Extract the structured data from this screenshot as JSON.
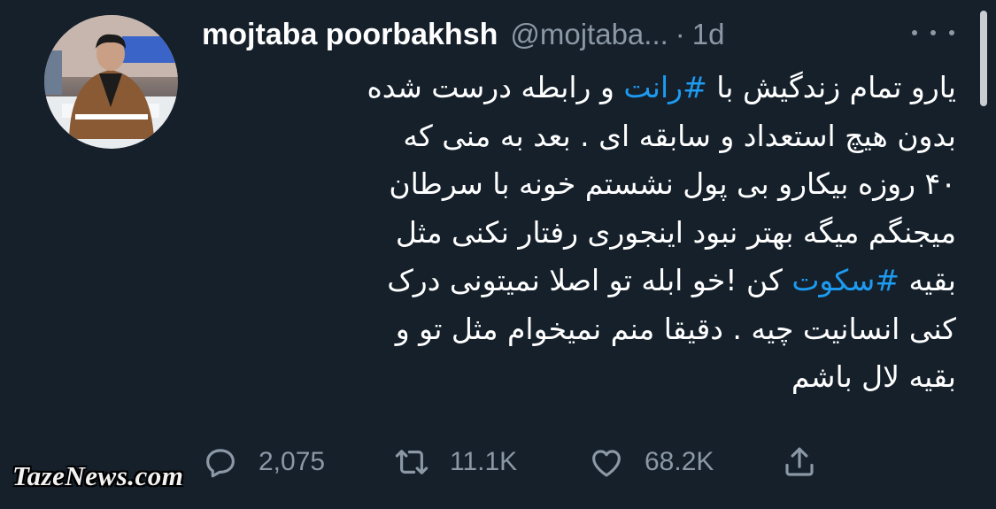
{
  "author": {
    "display_name": "mojtaba poorbakhsh",
    "handle": "@mojtaba...",
    "separator": "·",
    "time": "1d"
  },
  "tweet": {
    "lines": [
      [
        {
          "text": "یارو تمام زندگیش با "
        },
        {
          "text": "#رانت",
          "hashtag": true
        },
        {
          "text": " و رابطه درست شده"
        }
      ],
      [
        {
          "text": "بدون هیچ استعداد و سابقه ای  . بعد به منی که"
        }
      ],
      [
        {
          "text": "۴۰ روزه بیکارو بی پول نشستم خونه با سرطان"
        }
      ],
      [
        {
          "text": "میجنگم میگه بهتر نبود اینجوری رفتار نکنی مثل"
        }
      ],
      [
        {
          "text": "بقیه "
        },
        {
          "text": "#سکوت",
          "hashtag": true
        },
        {
          "text": " کن !خو ابله تو اصلا نمیتونی درک"
        }
      ],
      [
        {
          "text": "کنی انسانیت چیه . دقیقا منم نمیخوام مثل تو و"
        }
      ],
      [
        {
          "text": "بقیه لال باشم"
        }
      ]
    ]
  },
  "actions": {
    "reply_icon": "reply-icon",
    "reply_count": "2,075",
    "retweet_icon": "retweet-icon",
    "retweet_count": "11.1K",
    "like_icon": "like-icon",
    "like_count": "68.2K",
    "share_icon": "share-icon"
  },
  "more_icon": "more-icon",
  "watermark": "TazeNews.com",
  "colors": {
    "background": "#15202b",
    "text": "#ffffff",
    "secondary": "#8b98a5",
    "hashtag": "#1d9bf0"
  }
}
